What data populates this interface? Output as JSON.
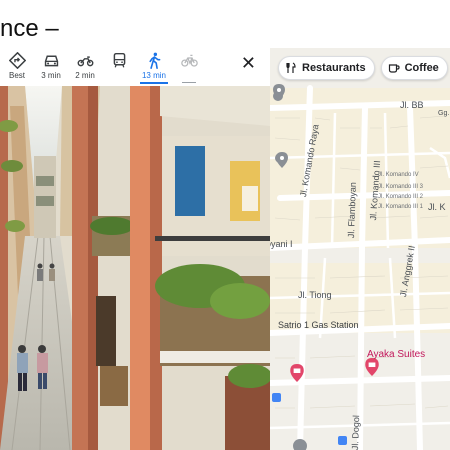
{
  "slide_title": "nce –",
  "travel_modes": [
    {
      "name": "best",
      "label": "Best"
    },
    {
      "name": "drive",
      "label": "3 min"
    },
    {
      "name": "motorcycle",
      "label": "2 min"
    },
    {
      "name": "transit",
      "label": ""
    },
    {
      "name": "walk",
      "label": "13 min",
      "active": true
    },
    {
      "name": "bicycle",
      "label": ""
    }
  ],
  "close_glyph": "✕",
  "map": {
    "chips": [
      {
        "icon": "restaurant-icon",
        "label": "Restaurants"
      },
      {
        "icon": "coffee-icon",
        "label": "Coffee"
      },
      {
        "icon": "cart-icon",
        "label": ""
      }
    ],
    "road_labels": {
      "bb": "Jl. BB",
      "gg": "Gg.",
      "komando_raya": "Jl. Komando Raya",
      "flamboyan": "Jl. Flamboyan",
      "komando_iii": "Jl. Komando III",
      "komando_iv": "Jl. Komando IV",
      "komando_ii3": "Jl. Komando III 3",
      "komando_iii2": "Jl. Komando III 2",
      "komando_iii1": "Jl. Komando III 1",
      "k": "Jl. K",
      "oyani": "oyani I",
      "anggrek": "Jl. Anggrek II",
      "tiong": "Jl. Tiong",
      "dogol": "Jl. Dogol"
    },
    "gas_station": "Satrio 1 Gas Station",
    "hotel": "Ayaka Suites"
  },
  "colors": {
    "accent": "#1a73e8",
    "poi": "#e2466a",
    "hotel_text": "#c2185b",
    "map_bg": "#f1efe9",
    "road": "#ffffff"
  }
}
